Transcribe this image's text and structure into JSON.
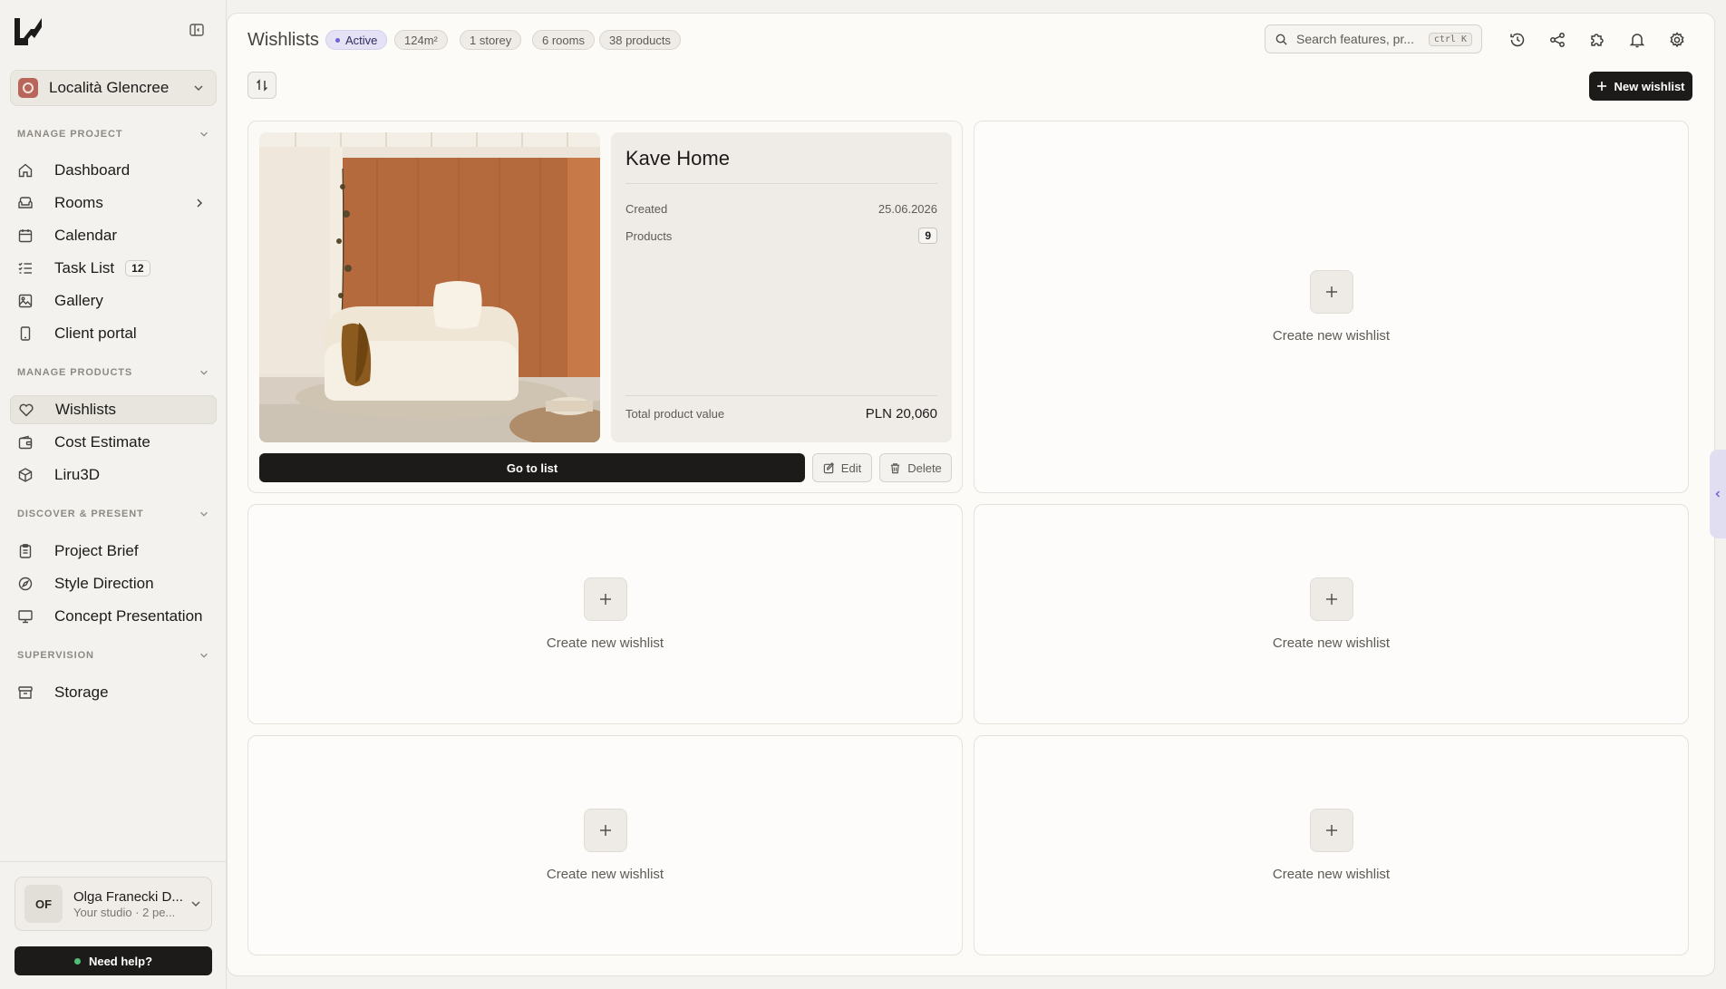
{
  "sidebar": {
    "project": "Località Glencree",
    "sections": [
      {
        "title": "MANAGE PROJECT"
      },
      {
        "title": "MANAGE PRODUCTS"
      },
      {
        "title": "DISCOVER & PRESENT"
      },
      {
        "title": "SUPERVISION"
      }
    ],
    "items": [
      {
        "label": "Dashboard",
        "icon": "home-icon"
      },
      {
        "label": "Rooms",
        "icon": "sofa-icon"
      },
      {
        "label": "Calendar",
        "icon": "calendar-icon"
      },
      {
        "label": "Task List",
        "icon": "list-check-icon",
        "badge": "12"
      },
      {
        "label": "Gallery",
        "icon": "image-icon"
      },
      {
        "label": "Client portal",
        "icon": "phone-icon"
      },
      {
        "label": "Wishlists",
        "icon": "heart-icon",
        "active": true
      },
      {
        "label": "Cost Estimate",
        "icon": "wallet-icon"
      },
      {
        "label": "Liru3D",
        "icon": "cube-icon"
      },
      {
        "label": "Project Brief",
        "icon": "clipboard-icon"
      },
      {
        "label": "Style Direction",
        "icon": "compass-icon"
      },
      {
        "label": "Concept Presentation",
        "icon": "presentation-icon"
      },
      {
        "label": "Storage",
        "icon": "archive-icon"
      }
    ],
    "user": {
      "initials": "OF",
      "name": "Olga Franecki D...",
      "subtitle": "Your studio · 2 pe..."
    },
    "help_label": "Need help?"
  },
  "header": {
    "title": "Wishlists",
    "chips": [
      "Active",
      "124m²",
      "1 storey",
      "6 rooms",
      "38 products"
    ],
    "search_placeholder": "Search features, pr...",
    "search_shortcut": "ctrl K",
    "new_button": "New wishlist"
  },
  "wishlist": {
    "name": "Kave Home",
    "created_label": "Created",
    "created_value": "25.06.2026",
    "products_label": "Products",
    "products_value": "9",
    "total_label": "Total product value",
    "total_value": "PLN 20,060",
    "goto_label": "Go to list",
    "edit_label": "Edit",
    "delete_label": "Delete"
  },
  "empty_slot_label": "Create new wishlist",
  "colors": {
    "accent": "#1c1b19",
    "active_chip": "#6c64d6",
    "help_dot": "#4fbf74"
  }
}
